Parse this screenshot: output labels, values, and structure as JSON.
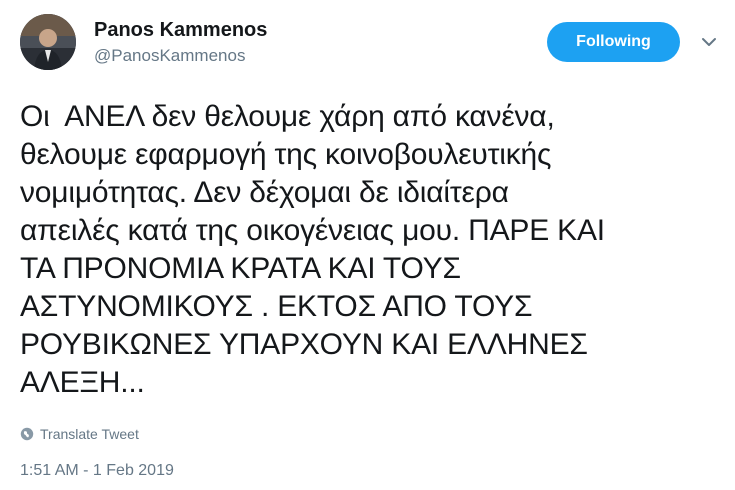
{
  "user": {
    "display_name": "Panos Kammenos",
    "handle": "@PanosKammenos"
  },
  "follow_button": {
    "label": "Following",
    "color": "#1da1f2"
  },
  "menu": {
    "icon": "chevron-down-icon"
  },
  "tweet": {
    "text": "Οι  ΑΝΕΛ δεν θελουμε χάρη από κανένα,\nθελουμε εφαρμογή της κοινοβουλευτικής\nνομιμότητας. Δεν δέχομαι δε ιδιαίτερα\nαπειλές κατά της οικογένειας μου. ΠΑΡΕ ΚΑΙ\nΤΑ ΠΡΟΝΟΜΙΑ ΚΡΑΤΑ ΚΑΙ ΤΟΥΣ\nΑΣΤΥΝΟΜΙΚΟΥΣ . ΕΚΤΟΣ ΑΠΟ ΤΟΥΣ\nΡΟΥΒΙΚΩΝΕΣ ΥΠΑΡΧΟΥΝ ΚΑΙ ΕΛΛΗΝΕΣ\nΑΛΕΞΗ...",
    "translate_label": "Translate Tweet",
    "timestamp": "1:51 AM - 1 Feb 2019"
  }
}
